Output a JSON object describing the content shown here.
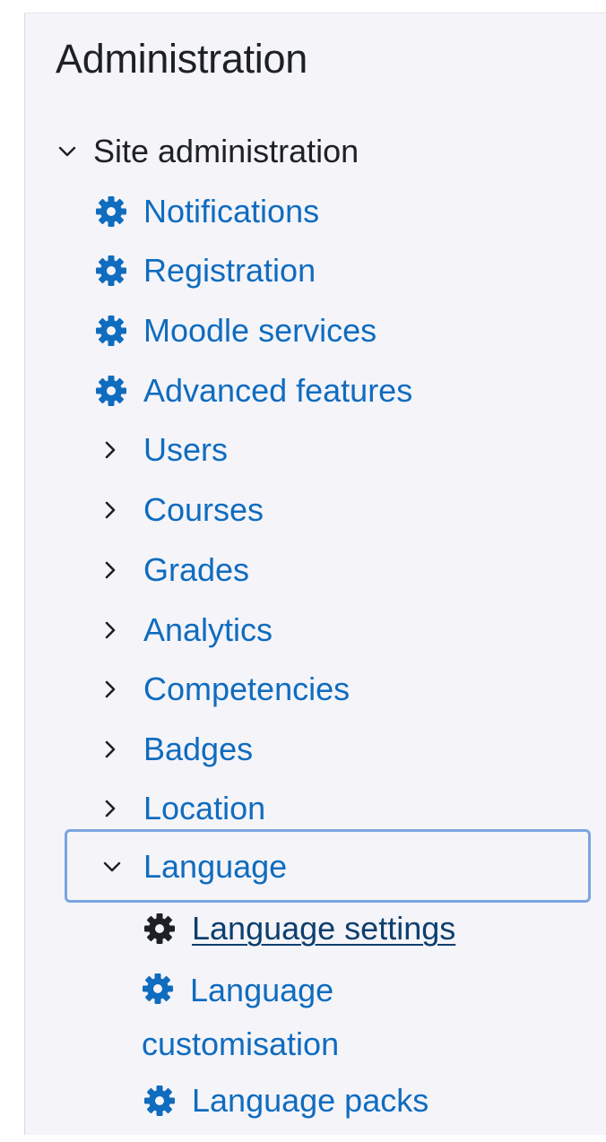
{
  "panel": {
    "title": "Administration"
  },
  "tree": {
    "root": {
      "label": "Site administration",
      "expanded": true
    },
    "settings": [
      {
        "label": "Notifications",
        "icon": "gear-icon"
      },
      {
        "label": "Registration",
        "icon": "gear-icon"
      },
      {
        "label": "Moodle services",
        "icon": "gear-icon"
      },
      {
        "label": "Advanced features",
        "icon": "gear-icon"
      }
    ],
    "categories": [
      {
        "label": "Users",
        "expanded": false
      },
      {
        "label": "Courses",
        "expanded": false
      },
      {
        "label": "Grades",
        "expanded": false
      },
      {
        "label": "Analytics",
        "expanded": false
      },
      {
        "label": "Competencies",
        "expanded": false
      },
      {
        "label": "Badges",
        "expanded": false
      },
      {
        "label": "Location",
        "expanded": false
      }
    ],
    "language": {
      "label": "Language",
      "expanded": true,
      "focused": true,
      "children": [
        {
          "label": "Language settings",
          "icon": "gear-icon",
          "hovered": true
        },
        {
          "label": "Language customisation",
          "icon": "gear-icon"
        },
        {
          "label": "Language packs",
          "icon": "gear-icon"
        }
      ]
    }
  },
  "colors": {
    "link": "#0f6cbf",
    "text": "#1d2125",
    "focus": "#7aa5e0",
    "panel_bg": "#f5f4f9"
  }
}
